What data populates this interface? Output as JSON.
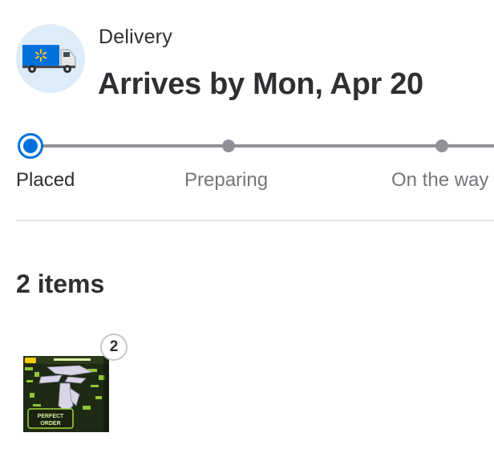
{
  "delivery": {
    "type_label": "Delivery",
    "arrival_text": "Arrives by Mon, Apr 20",
    "icon": "delivery-truck-icon"
  },
  "progress": {
    "steps": [
      {
        "label": "Placed",
        "state": "active"
      },
      {
        "label": "Preparing",
        "state": "pending"
      },
      {
        "label": "On the way",
        "state": "pending"
      }
    ],
    "active_color": "#0071dc",
    "inactive_color": "#909196"
  },
  "items": {
    "heading": "2 items",
    "list": [
      {
        "quantity": "2",
        "image": "product-thumbnail",
        "box_text": "PERFECT ORDER"
      }
    ]
  }
}
